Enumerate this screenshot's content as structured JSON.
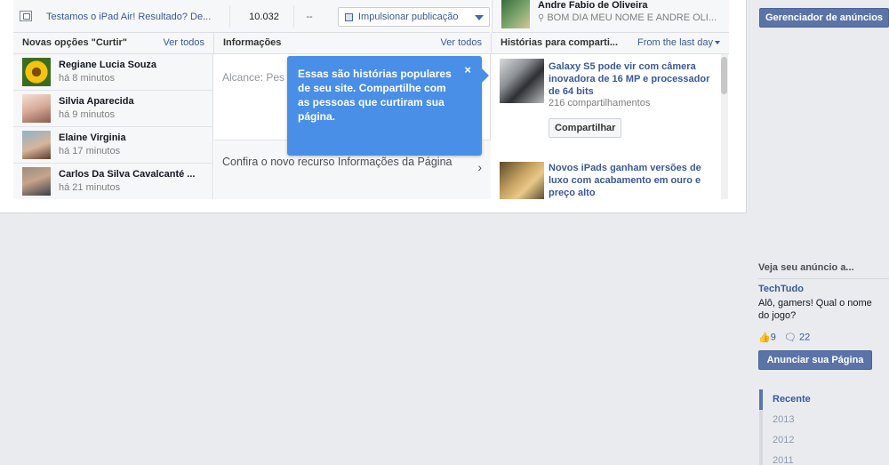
{
  "top_post": {
    "title": "Testamos o iPad Air! Resultado? De...",
    "reach": "10.032",
    "engagement": "--",
    "boost_label": "Impulsionar publicação"
  },
  "top_user": {
    "name": "Andre Fabio de Oliveira",
    "message": "BOM DIA MEU NOME E ANDRE OLI..."
  },
  "likes": {
    "title": "Novas opções \"Curtir\"",
    "view_all": "Ver todos",
    "items": [
      {
        "name": "Regiane Lucia Souza",
        "time": "há 8 minutos"
      },
      {
        "name": "Silvia Aparecida",
        "time": "há 9 minutos"
      },
      {
        "name": "Elaine Virginia",
        "time": "há 17 minutos"
      },
      {
        "name": "Carlos Da Silva Cavalcanté ...",
        "time": "há 21 minutos"
      }
    ]
  },
  "info": {
    "title": "Informações",
    "view_all": "Ver todos",
    "reach_label": "Alcance: Pes",
    "feature_text": "Confira o novo recurso Informações da Página"
  },
  "tooltip": {
    "text": "Essas são histórias populares de seu site. Compartilhe com as pessoas que curtiram sua página.",
    "close": "×"
  },
  "stories": {
    "title": "Histórias para comparti...",
    "filter": "From the last day",
    "items": [
      {
        "title": "Galaxy S5 pode vir com câmera inovadora de 16 MP e processador de 64 bits",
        "shares": "216 compartilhamentos",
        "share_label": "Compartilhar"
      },
      {
        "title": "Novos iPads ganham versões de luxo com acabamento em ouro e preço alto"
      }
    ]
  },
  "sidebar": {
    "ads_manager": "Gerenciador de anúncios",
    "ad_heading": "Veja seu anúncio a...",
    "ad_page": "TechTudo",
    "ad_text": "Alô, gamers! Qual o nome do jogo?",
    "ad_likes": "9",
    "ad_comments": "22",
    "ad_button": "Anunciar sua Página",
    "timeline": [
      "Recente",
      "2013",
      "2012",
      "2011"
    ]
  },
  "colors": {
    "link": "#3b5998",
    "tooltip_bg": "#4a8fe7",
    "button_bg": "#5b74a8",
    "page_bg": "#e9ebee"
  }
}
